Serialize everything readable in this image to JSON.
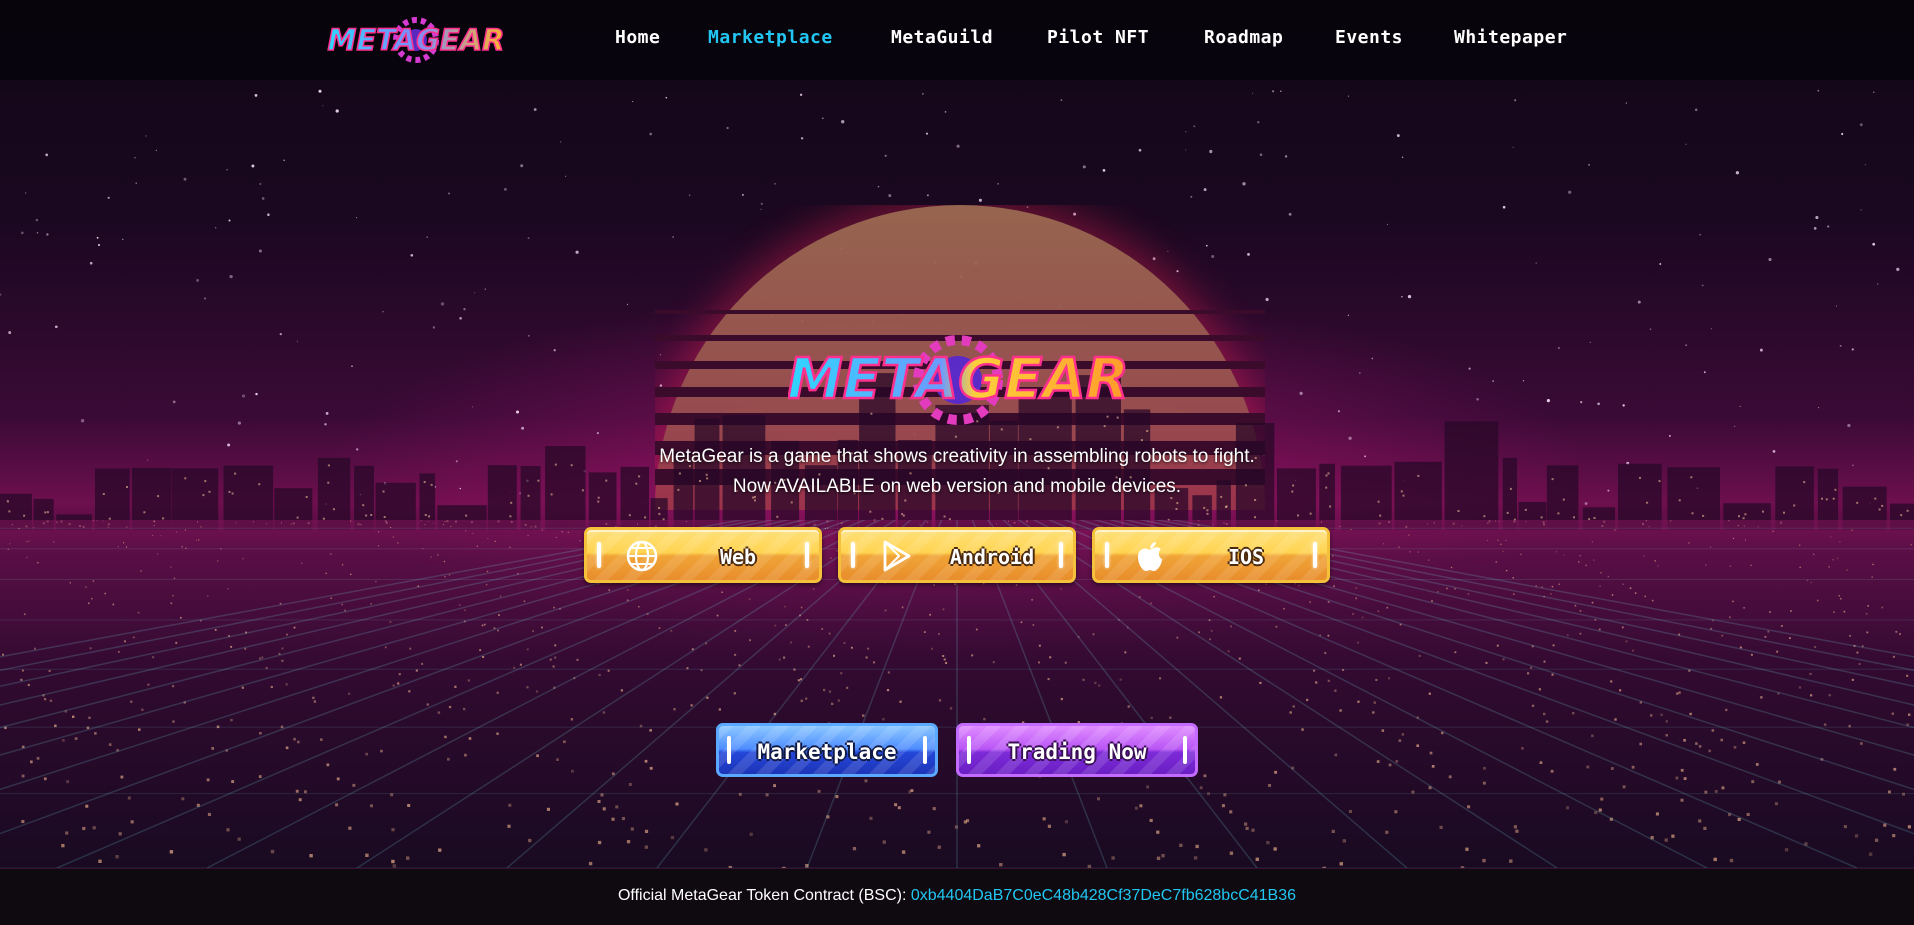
{
  "header": {
    "logo_text": "METAGEAR",
    "nav": [
      {
        "label": "Home",
        "active": false
      },
      {
        "label": "Marketplace",
        "active": true
      },
      {
        "label": "MetaGuild",
        "active": false
      },
      {
        "label": "Pilot NFT",
        "active": false
      },
      {
        "label": "Roadmap",
        "active": false
      },
      {
        "label": "Events",
        "active": false
      },
      {
        "label": "Whitepaper",
        "active": false
      }
    ]
  },
  "hero": {
    "logo_text": "METAGEAR",
    "tagline_line1": "MetaGear is a game that shows creativity in assembling robots to fight.",
    "tagline_line2": "Now AVAILABLE on web version and mobile devices.",
    "platform_buttons": [
      {
        "label": "Web",
        "icon": "globe-icon"
      },
      {
        "label": "Android",
        "icon": "play-store-icon"
      },
      {
        "label": "IOS",
        "icon": "apple-icon"
      }
    ],
    "marketplace_button": "Marketplace",
    "trading_button": "Trading Now"
  },
  "footer": {
    "label": "Official MetaGear Token Contract (BSC):",
    "contract_address": "0xb4404DaB7C0eC48b428Cf37DeC7fb628bcC41B36"
  },
  "colors": {
    "accent_cyan": "#22c6f2",
    "button_gold": "#ffd451",
    "button_blue": "#4d8cff",
    "button_purple": "#b955f5",
    "background": "#1a0820"
  }
}
